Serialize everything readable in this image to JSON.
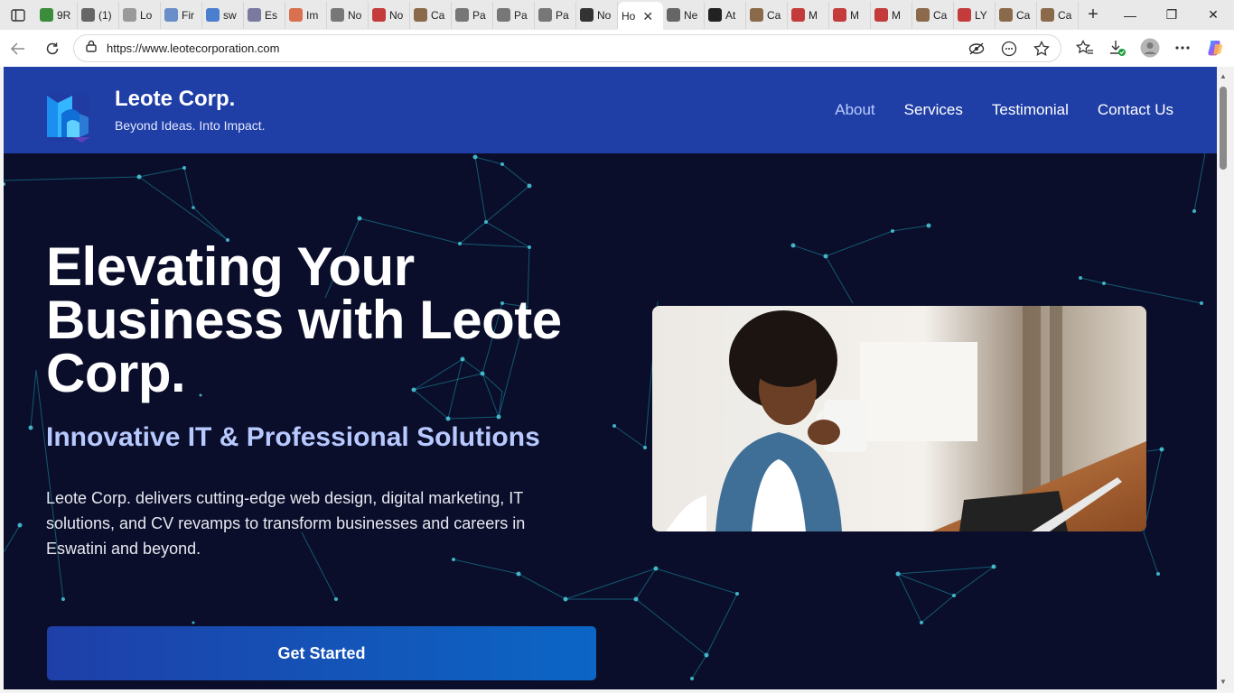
{
  "browser": {
    "tabs": [
      {
        "label": "9R",
        "icon": "app-icon",
        "color": "#3b8d3b"
      },
      {
        "label": "(1)",
        "icon": "notification-icon",
        "color": "#666666"
      },
      {
        "label": "Lo",
        "icon": "document-icon",
        "color": "#9a9a9a"
      },
      {
        "label": "Fir",
        "icon": "cloud-icon",
        "color": "#6a8fc8"
      },
      {
        "label": "sw",
        "icon": "search-icon",
        "color": "#4a7fd0"
      },
      {
        "label": "Es",
        "icon": "image-icon",
        "color": "#7a7aa0"
      },
      {
        "label": "Im",
        "icon": "asterisk-icon",
        "color": "#d97050"
      },
      {
        "label": "No",
        "icon": "globe-icon",
        "color": "#777777"
      },
      {
        "label": "No",
        "icon": "pdf-icon",
        "color": "#c43b3b"
      },
      {
        "label": "Ca",
        "icon": "people-icon",
        "color": "#8a6a4a"
      },
      {
        "label": "Pa",
        "icon": "globe-icon",
        "color": "#777777"
      },
      {
        "label": "Pa",
        "icon": "globe-icon",
        "color": "#777777"
      },
      {
        "label": "Pa",
        "icon": "globe-icon",
        "color": "#777777"
      },
      {
        "label": "No",
        "icon": "globe-icon",
        "color": "#333333"
      }
    ],
    "active_tab": {
      "label": "Ho",
      "close": "✕"
    },
    "tabs_after": [
      {
        "label": "Ne",
        "icon": "newspaper-icon",
        "color": "#666666"
      },
      {
        "label": "At",
        "icon": "openai-icon",
        "color": "#222222"
      },
      {
        "label": "Ca",
        "icon": "people-icon",
        "color": "#8a6a4a"
      },
      {
        "label": "M",
        "icon": "pdf-icon",
        "color": "#c43b3b"
      },
      {
        "label": "M",
        "icon": "pdf-icon",
        "color": "#c43b3b"
      },
      {
        "label": "M",
        "icon": "pdf-icon",
        "color": "#c43b3b"
      },
      {
        "label": "Ca",
        "icon": "people-icon",
        "color": "#8a6a4a"
      },
      {
        "label": "LY",
        "icon": "pdf-icon",
        "color": "#c43b3b"
      },
      {
        "label": "Ca",
        "icon": "people-icon",
        "color": "#8a6a4a"
      },
      {
        "label": "Ca",
        "icon": "people-icon",
        "color": "#8a6a4a"
      }
    ],
    "new_tab": "+",
    "url": "https://www.leotecorporation.com",
    "window": {
      "minimize": "—",
      "maximize": "❐",
      "close": "✕"
    }
  },
  "site": {
    "brand_name": "Leote Corp.",
    "brand_tagline": "Beyond Ideas. Into Impact.",
    "nav": [
      "About",
      "Services",
      "Testimonial",
      "Contact Us"
    ],
    "accent_color": "#1f3ea6",
    "hero": {
      "title": "Elevating Your Business with Leote Corp.",
      "subtitle": "Innovative IT & Professional Solutions",
      "description": "Leote Corp. delivers cutting-edge web design, digital marketing, IT solutions, and CV revamps to transform businesses and careers in Eswatini and beyond.",
      "cta_label": "Get Started"
    }
  }
}
